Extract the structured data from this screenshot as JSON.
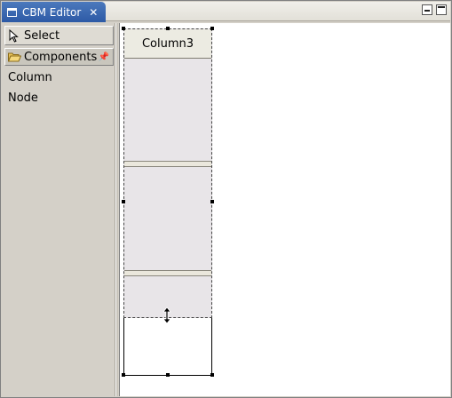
{
  "editor": {
    "tab_title": "CBM Editor",
    "tab_close": "✕"
  },
  "palette": {
    "select_label": "Select",
    "drawer_label": "Components",
    "items": [
      "Column",
      "Node"
    ]
  },
  "canvas": {
    "column_title": "Column3"
  },
  "colors": {
    "tab_active": "#2d5aa6",
    "palette_bg": "#d4d0c8",
    "column_fill": "#e8e5e8"
  }
}
